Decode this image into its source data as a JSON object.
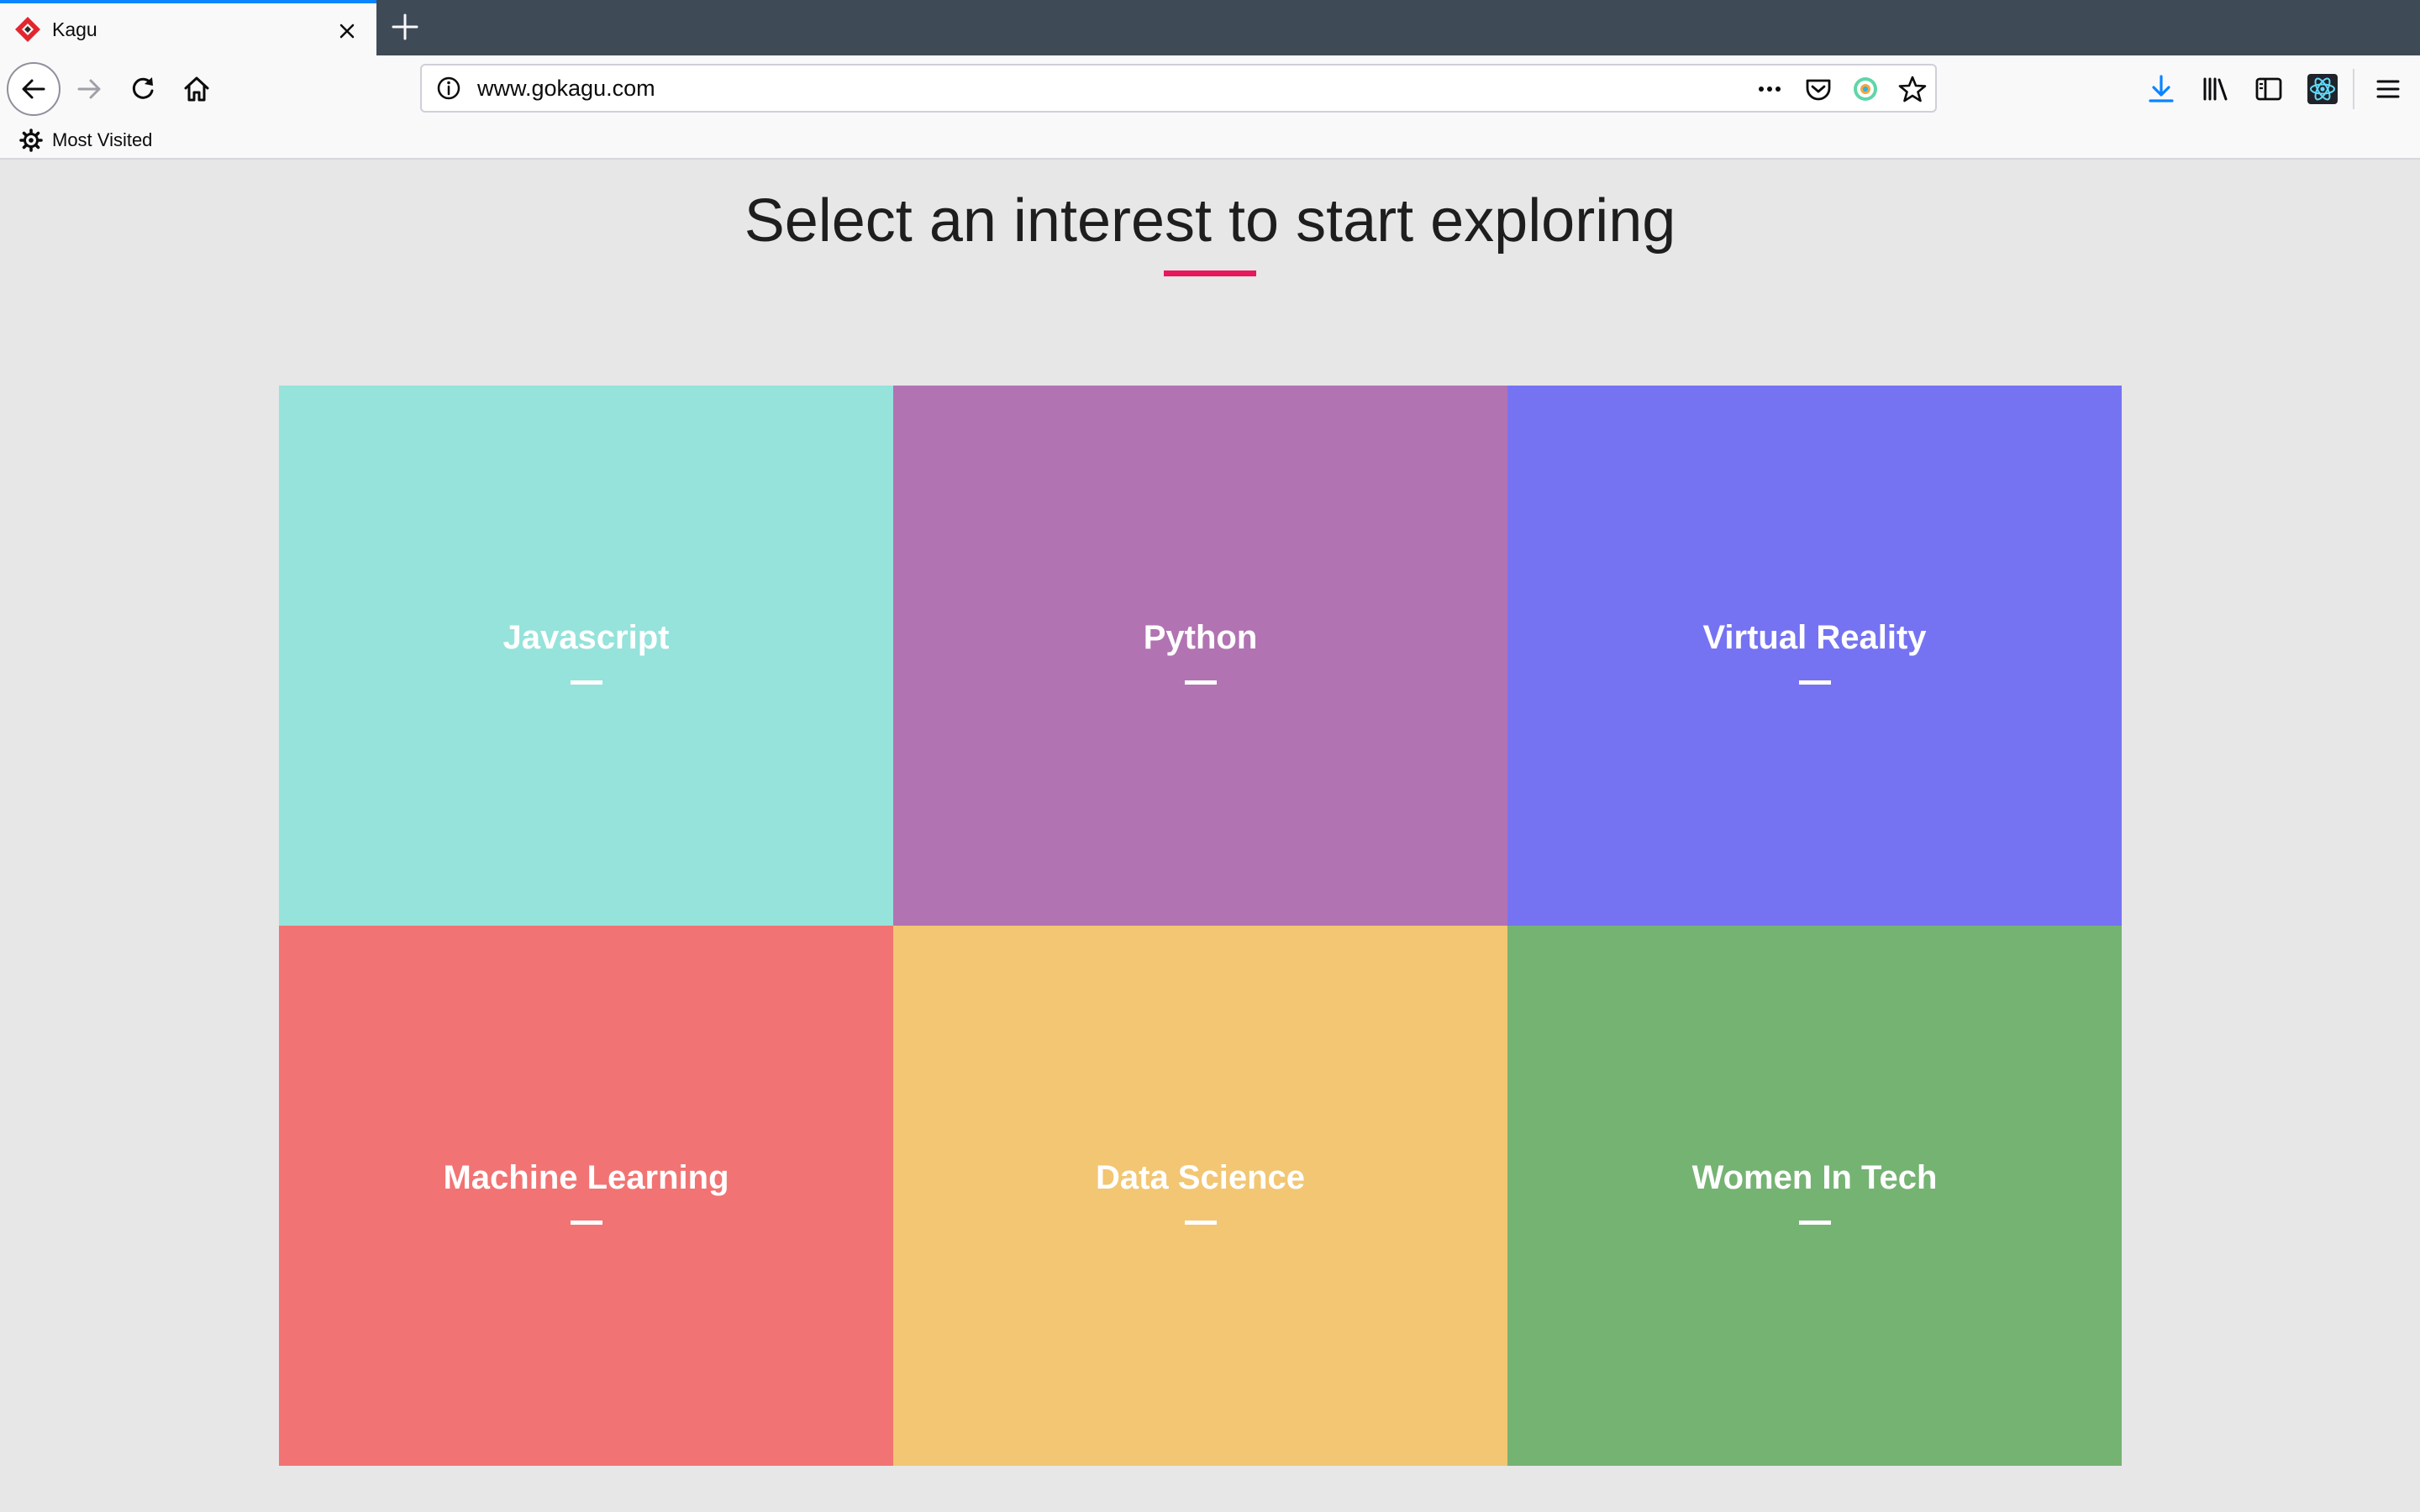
{
  "browser": {
    "tab": {
      "title": "Kagu",
      "favicon": "kagu-logo-icon"
    },
    "url": "www.gokagu.com",
    "bookmarks": [
      {
        "label": "Most Visited",
        "icon": "gear-icon"
      }
    ]
  },
  "page": {
    "heading": "Select an interest to start exploring",
    "accent_color": "#e8185c",
    "interests": [
      {
        "label": "Javascript",
        "color": "#95e3db"
      },
      {
        "label": "Python",
        "color": "#b273b2"
      },
      {
        "label": "Virtual Reality",
        "color": "#7573f2"
      },
      {
        "label": "Machine Learning",
        "color": "#f27373"
      },
      {
        "label": "Data Science",
        "color": "#f2c673"
      },
      {
        "label": "Women In Tech",
        "color": "#75b373"
      }
    ]
  }
}
